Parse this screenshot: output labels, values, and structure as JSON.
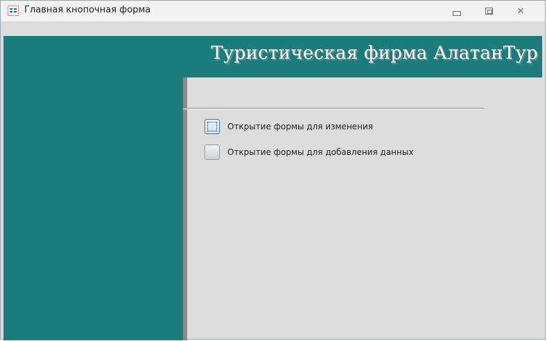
{
  "window": {
    "title": "Главная кнопочная форма"
  },
  "banner": {
    "title": "Туристическая фирма АлатанТур"
  },
  "menu": {
    "items": [
      {
        "label": "Открытие формы для изменения"
      },
      {
        "label": "Открытие формы для добавления данных"
      }
    ]
  },
  "colors": {
    "teal": "#1c7b7b",
    "form_background": "#dcdcdc",
    "separator": "#8a8a8a"
  },
  "icons": {
    "title": "form-icon",
    "minimize": "minimize-icon",
    "maximize": "maximize-icon",
    "close": "close-icon"
  }
}
